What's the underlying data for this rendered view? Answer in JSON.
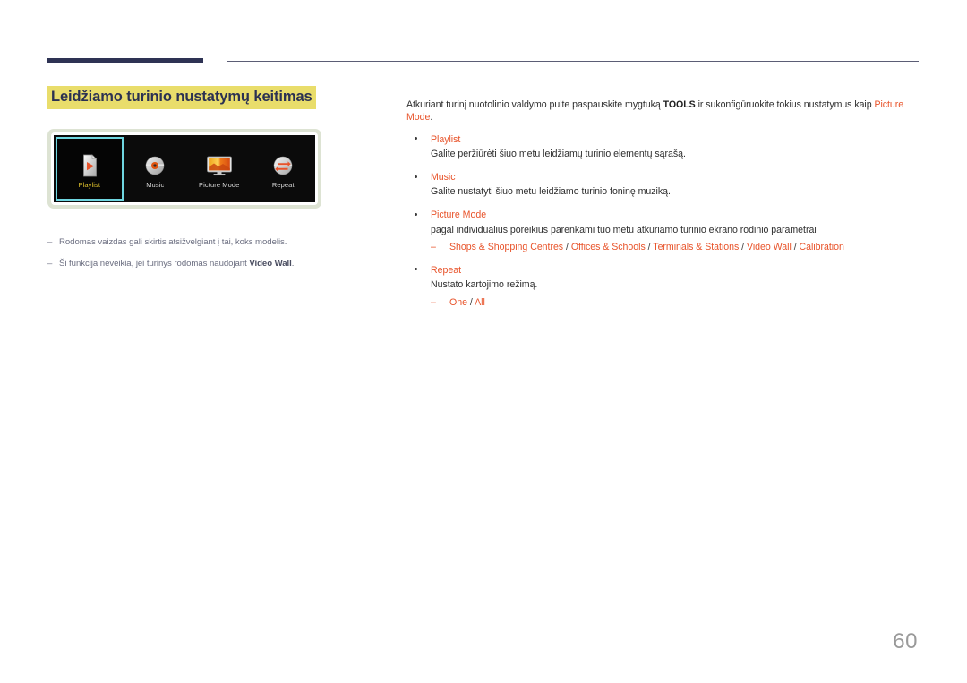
{
  "header": {
    "bar_label": "section-accent-bar",
    "rule_label": "header-rule"
  },
  "page_title": "Leidžiamo turinio nustatymų keitimas",
  "osd_menu": {
    "items": [
      {
        "label": "Playlist",
        "icon": "playlist-file-play-icon",
        "selected": true
      },
      {
        "label": "Music",
        "icon": "music-disc-icon",
        "selected": false
      },
      {
        "label": "Picture Mode",
        "icon": "picture-mode-monitor-icon",
        "selected": false
      },
      {
        "label": "Repeat",
        "icon": "repeat-arrows-icon",
        "selected": false
      }
    ],
    "selected_border_color": "#6fd6e0",
    "selected_label_color": "#e2c32c",
    "frame_color": "#dde3d3",
    "panel_color": "#0b0b0b"
  },
  "notes": [
    {
      "dash": "‒",
      "text": "Rodomas vaizdas gali skirtis atsižvelgiant į tai, koks modelis.",
      "bold": ""
    },
    {
      "dash": "‒",
      "text_before": "Ši funkcija neveikia, jei turinys rodomas naudojant ",
      "bold": "Video Wall",
      "text_after": "."
    }
  ],
  "intro": {
    "part1": "Atkuriant turinį nuotolinio valdymo pulte paspauskite mygtuką ",
    "key": "TOOLS",
    "part2": " ir sukonfigūruokite tokius nustatymus kaip ",
    "accent": "Picture Mode",
    "part3": "."
  },
  "bullets": [
    {
      "head": "Playlist",
      "desc": "Galite peržiūrėti šiuo metu leidžiamų turinio elementų sąrašą.",
      "sub": null
    },
    {
      "head": "Music",
      "desc": "Galite nustatyti šiuo metu leidžiamo turinio foninę muziką.",
      "sub": null
    },
    {
      "head": "Picture Mode",
      "desc": "pagal individualius poreikius parenkami tuo metu atkuriamo turinio ekrano rodinio parametrai",
      "sub": {
        "dash": "‒",
        "options": [
          "Shops & Shopping Centres",
          "Offices & Schools",
          "Terminals & Stations",
          "Video Wall",
          "Calibration"
        ],
        "separator": " / "
      }
    },
    {
      "head": "Repeat",
      "desc": "Nustato kartojimo režimą.",
      "sub": {
        "dash": "‒",
        "options": [
          "One",
          "All"
        ],
        "separator": " / "
      }
    }
  ],
  "page_number": "60",
  "colors": {
    "accent_orange": "#e8532a",
    "navy": "#2e3354",
    "highlight_yellow": "#e9dd6b",
    "page_number_gray": "#9a9a9a"
  }
}
